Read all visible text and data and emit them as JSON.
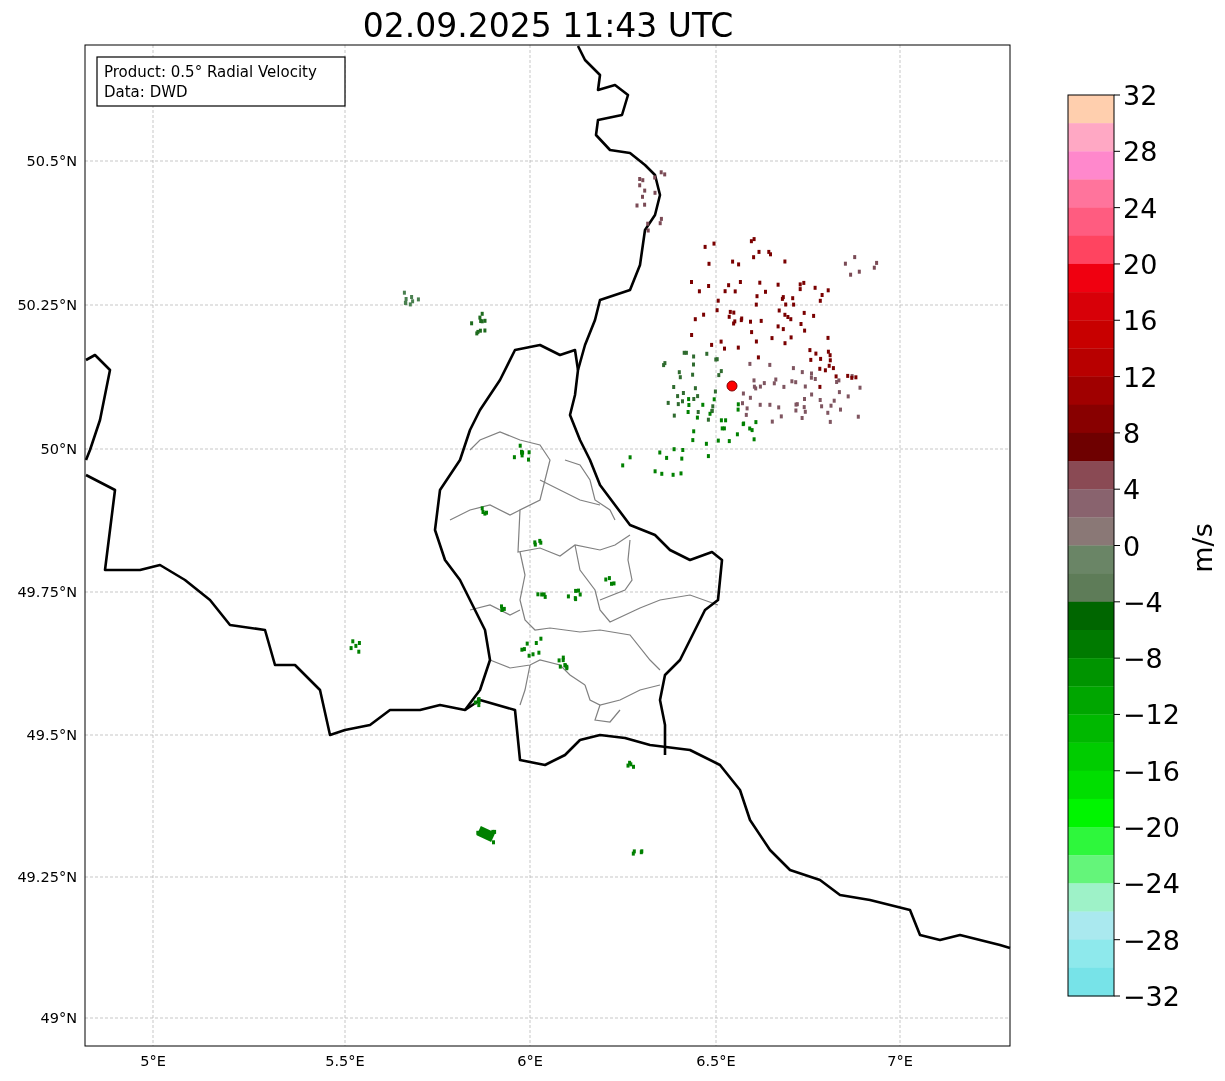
{
  "title": "02.09.2025 11:43 UTC",
  "info_box": {
    "lines": [
      "Product: 0.5° Radial Velocity",
      "Data: DWD"
    ]
  },
  "x_ticks": [
    "5°E",
    "5.5°E",
    "6°E",
    "6.5°E",
    "7°E"
  ],
  "y_ticks": [
    "50.5°N",
    "50.25°N",
    "50°N",
    "49.75°N",
    "49.5°N",
    "49.25°N",
    "49°N"
  ],
  "colorbar": {
    "label": "m/s",
    "ticks": [
      "32",
      "28",
      "24",
      "20",
      "16",
      "12",
      "8",
      "4",
      "0",
      "−4",
      "−8",
      "−12",
      "−16",
      "−20",
      "−24",
      "−28",
      "−32"
    ],
    "segments": [
      {
        "color": "#ffcfae"
      },
      {
        "color": "#ffa8c4"
      },
      {
        "color": "#ff88cc"
      },
      {
        "color": "#ff749c"
      },
      {
        "color": "#ff5c80"
      },
      {
        "color": "#ff4460"
      },
      {
        "color": "#f00010"
      },
      {
        "color": "#d80008"
      },
      {
        "color": "#c80000"
      },
      {
        "color": "#b80000"
      },
      {
        "color": "#a00000"
      },
      {
        "color": "#880000"
      },
      {
        "color": "#6e0000"
      },
      {
        "color": "#8a4a54"
      },
      {
        "color": "#89636e"
      },
      {
        "color": "#8a7876"
      },
      {
        "color": "#6a8566"
      },
      {
        "color": "#5e7c58"
      },
      {
        "color": "#006600"
      },
      {
        "color": "#007a00"
      },
      {
        "color": "#009400"
      },
      {
        "color": "#00a600"
      },
      {
        "color": "#00b800"
      },
      {
        "color": "#00cc00"
      },
      {
        "color": "#00de00"
      },
      {
        "color": "#00f500"
      },
      {
        "color": "#2ef73c"
      },
      {
        "color": "#64f57a"
      },
      {
        "color": "#9ef2c8"
      },
      {
        "color": "#aae9ef"
      },
      {
        "color": "#8ee9ec"
      },
      {
        "color": "#77e3e8"
      }
    ]
  }
}
